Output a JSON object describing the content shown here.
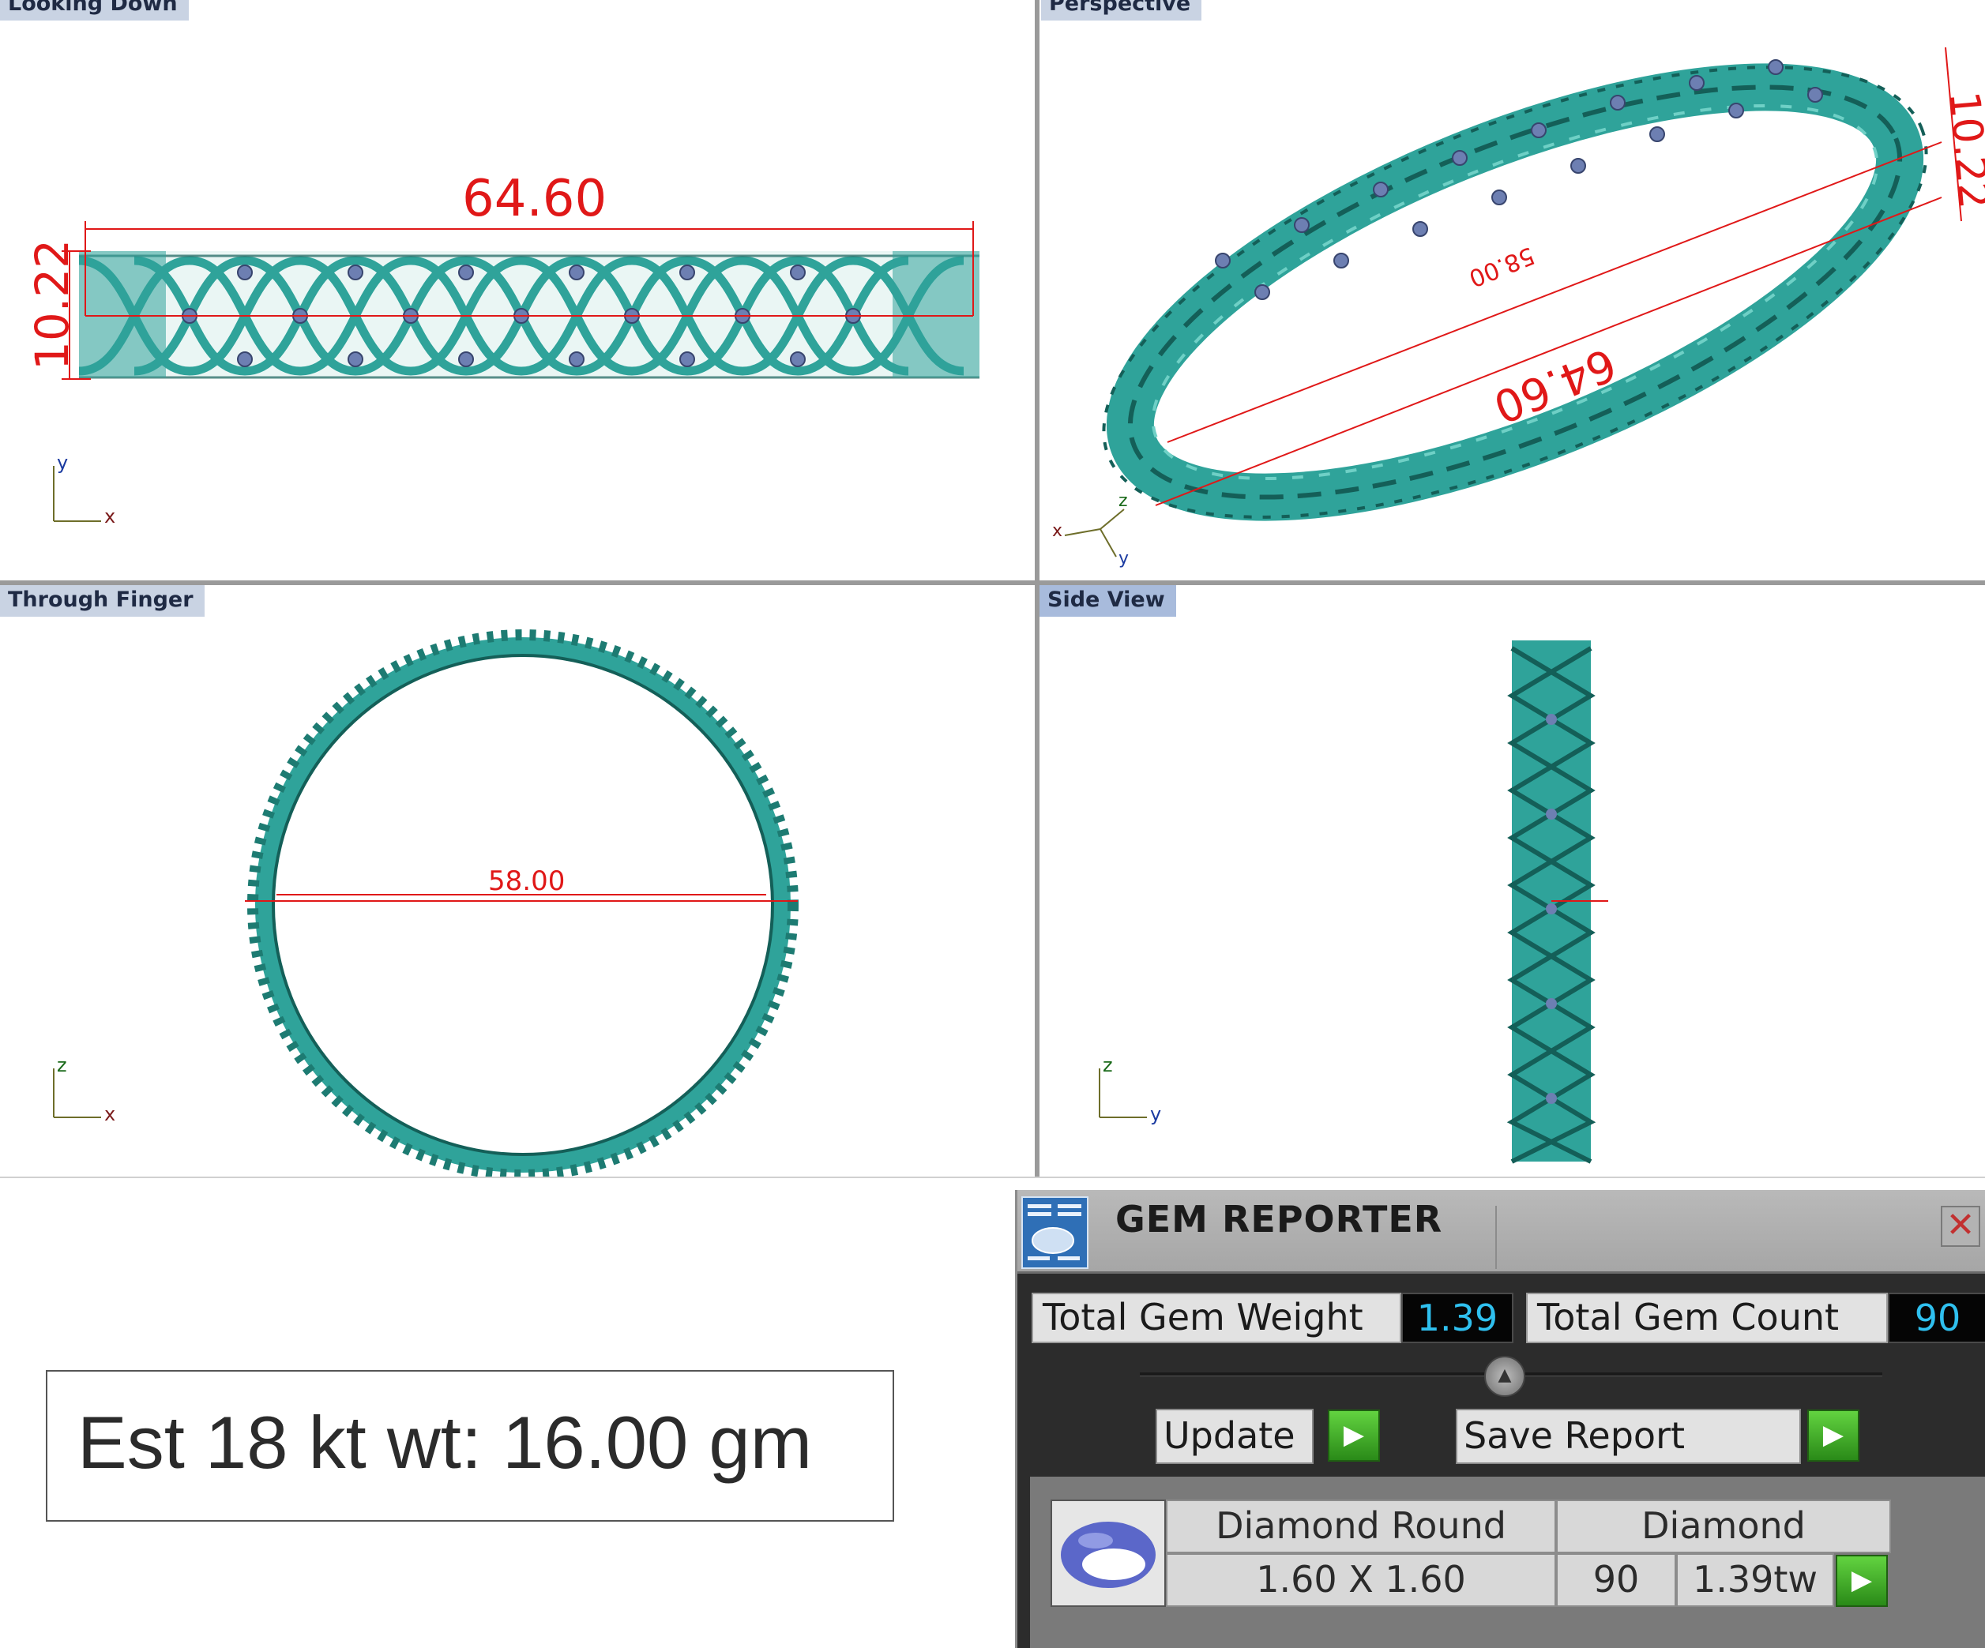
{
  "viewports": {
    "looking_down": {
      "title": "Looking Down",
      "dim_width": "64.60",
      "dim_height": "10.22",
      "axis_y": "y",
      "axis_x": "x"
    },
    "perspective": {
      "title": "Perspective",
      "dim_width": "64.60",
      "dim_height": "10.22",
      "dim_inner": "58.00",
      "axis_z": "z",
      "axis_x": "x",
      "axis_y": "y"
    },
    "through_finger": {
      "title": "Through Finger",
      "dim_diameter": "58.00",
      "axis_z": "z",
      "axis_x": "x"
    },
    "side_view": {
      "title": "Side View",
      "axis_z": "z",
      "axis_y": "y"
    }
  },
  "weight_note": "Est 18 kt wt: 16.00 gm",
  "gem_reporter": {
    "title": "GEM REPORTER",
    "close_label": "✕",
    "total_weight_label": "Total Gem Weight",
    "total_weight_value": "1.39",
    "total_count_label": "Total Gem Count",
    "total_count_value": "90",
    "update_label": "Update",
    "save_report_label": "Save Report",
    "gem_row": {
      "shape": "Diamond Round",
      "type": "Diamond",
      "size": "1.60 X 1.60",
      "count": "90",
      "weight": "1.39tw"
    }
  },
  "colors": {
    "metal": "#2fa39a",
    "metal_dark": "#145f58",
    "stone": "#6d7fb2",
    "dimension": "#e01818",
    "viewport_tab": "#c9d3e3",
    "counter_text": "#2fc0ef",
    "go_button": "#3fae26"
  }
}
